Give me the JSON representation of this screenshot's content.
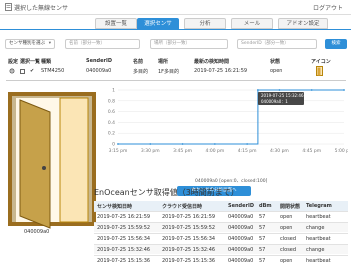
{
  "header": {
    "title": "選択した無線センサ",
    "logout": "ログアウト"
  },
  "tabs": [
    {
      "label": "設置一覧",
      "active": false
    },
    {
      "label": "選択センサ",
      "active": true
    },
    {
      "label": "分析",
      "active": false
    },
    {
      "label": "メール",
      "active": false
    },
    {
      "label": "アドオン設定",
      "active": false
    }
  ],
  "filters": {
    "sensor_type": {
      "value": "センサ種別を選ぶ"
    },
    "name_placeholder": "名前（部分一致）",
    "place_placeholder": "場所（部分一致）",
    "sender_placeholder": "SenderID（部分一致）",
    "search_label": "検索"
  },
  "sensor_table": {
    "headers": [
      "設定",
      "選択",
      "一覧",
      "種類",
      "SenderID",
      "名前",
      "場所",
      "最新の検知時間",
      "状態",
      "アイコン"
    ],
    "row": {
      "type": "STM4250",
      "sender_id": "040009a0",
      "name": "多目的",
      "place": "1F多目的",
      "last_detected": "2019-07-25 16:21:59",
      "state": "open"
    }
  },
  "door_caption": "040009a0",
  "chart_data": {
    "type": "line",
    "x": [
      "3:15 pm",
      "3:30 pm",
      "3:45 pm",
      "4:00 pm",
      "4:15 pm",
      "4:30 pm",
      "4:45 pm",
      "5:00 pm"
    ],
    "y_ticks": [
      "1",
      "0.8",
      "0.6",
      "0.4",
      "0.2",
      "0"
    ],
    "ylim": [
      0,
      1
    ],
    "series": [
      {
        "name": "040009a0",
        "points": [
          {
            "x": "3:15 pm",
            "y": 0
          },
          {
            "x": "3:30 pm",
            "y": 0
          },
          {
            "x": "3:45 pm",
            "y": 0
          },
          {
            "x": "4:00 pm",
            "y": 0
          },
          {
            "x": "4:15 pm",
            "y": 0
          },
          {
            "x": "4:20 pm",
            "y": 1
          },
          {
            "x": "4:30 pm",
            "y": 1
          },
          {
            "x": "4:45 pm",
            "y": 1
          },
          {
            "x": "5:00 pm",
            "y": 1
          }
        ]
      }
    ],
    "tooltip": {
      "title": "2019-07-25 15:32:46",
      "line": "040009a0：1"
    },
    "caption": "040009a0 [open:0、closed:100]",
    "button_label": "本センサの分析画面へ",
    "colors": {
      "line": "#2e8fd8"
    }
  },
  "eo_title": "EnOceanセンサ取得値（3時間前まで）",
  "eo_table": {
    "headers": [
      "センサ検知日時",
      "クラウド受信日時",
      "SenderID",
      "dBm",
      "開閉状態",
      "Telegram"
    ],
    "rows": [
      [
        "2019-07-25 16:21:59",
        "2019-07-25 16:21:59",
        "040009a0",
        "57",
        "open",
        "heartbeat"
      ],
      [
        "2019-07-25 15:59:52",
        "2019-07-25 15:59:52",
        "040009a0",
        "57",
        "open",
        "change"
      ],
      [
        "2019-07-25 15:56:34",
        "2019-07-25 15:56:34",
        "040009a0",
        "57",
        "closed",
        "heartbeat"
      ],
      [
        "2019-07-25 15:32:46",
        "2019-07-25 15:32:46",
        "040009a0",
        "57",
        "closed",
        "change"
      ],
      [
        "2019-07-25 15:15:36",
        "2019-07-25 15:15:36",
        "040009a0",
        "57",
        "open",
        "heartbeat"
      ]
    ]
  }
}
